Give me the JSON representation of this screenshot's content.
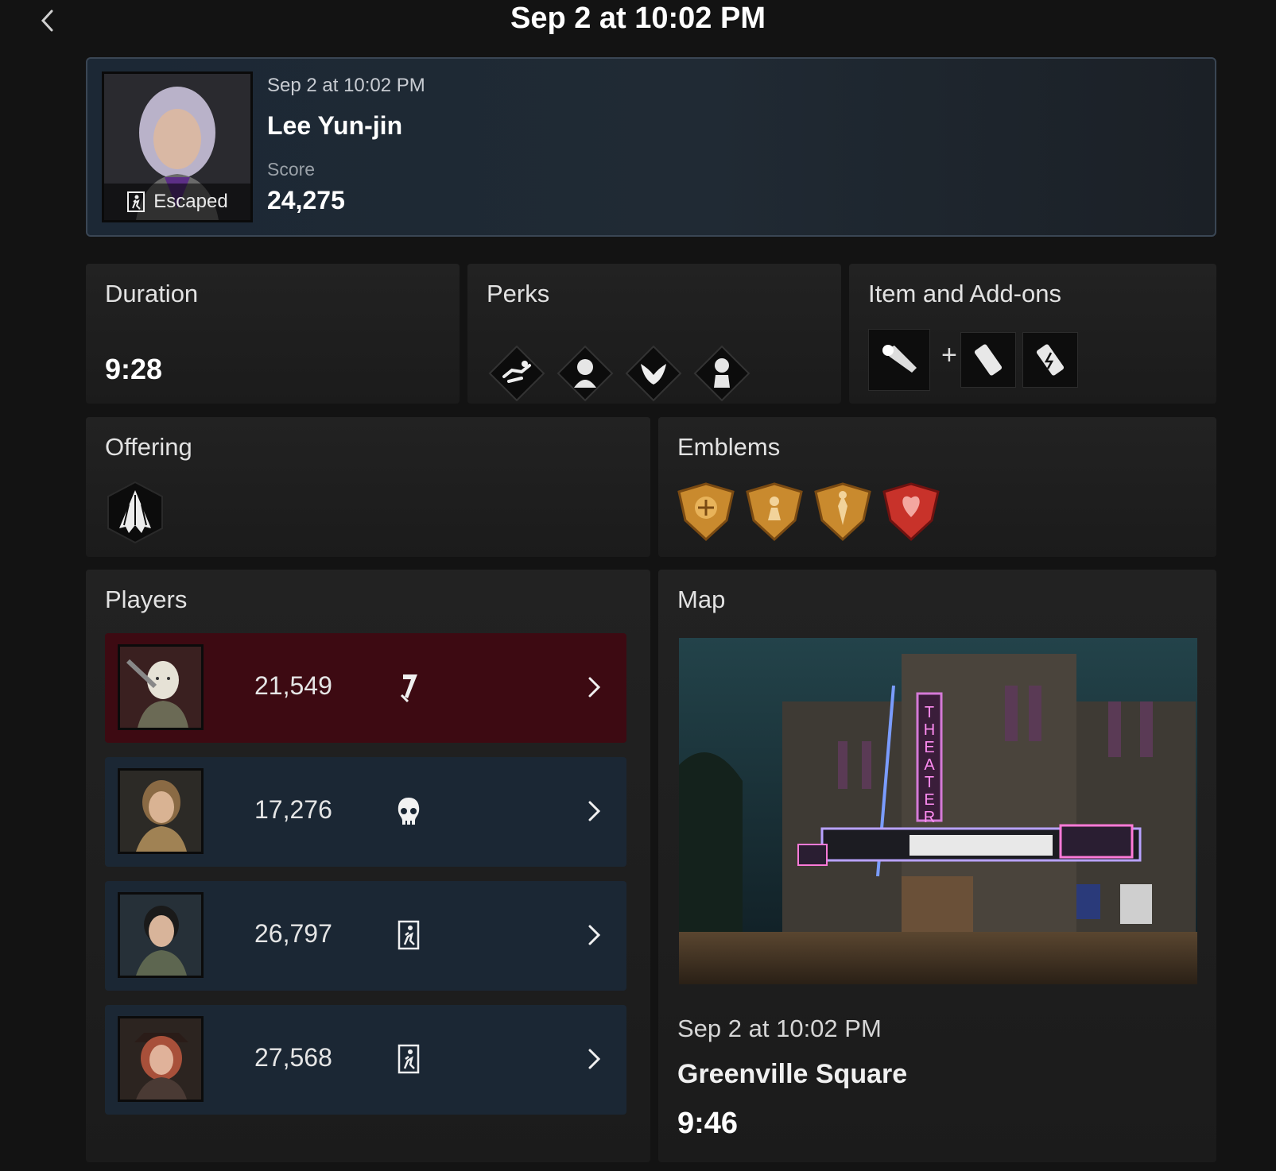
{
  "header": {
    "title": "Sep 2 at 10:02 PM"
  },
  "match": {
    "date": "Sep 2 at 10:02 PM",
    "character": "Lee Yun-jin",
    "status": "Escaped",
    "score_label": "Score",
    "score": "24,275"
  },
  "duration": {
    "title": "Duration",
    "value": "9:28"
  },
  "perks": {
    "title": "Perks",
    "icons": [
      "vault-perk-icon",
      "survivor-portrait-perk-icon",
      "wings-perk-icon",
      "bust-perk-icon"
    ]
  },
  "items": {
    "title": "Item and Add-ons",
    "plus": "+",
    "icons": [
      "flashlight-icon",
      "battery-icon",
      "battery-charged-icon"
    ]
  },
  "offering": {
    "title": "Offering",
    "icon": "shroud-offering-icon"
  },
  "emblems": {
    "title": "Emblems",
    "icons": [
      "gold-emblem-lightbringer-icon",
      "gold-emblem-unbroken-icon",
      "gold-emblem-benevolent-icon",
      "iridescent-emblem-evader-icon"
    ]
  },
  "players": {
    "title": "Players",
    "rows": [
      {
        "score": "21,549",
        "status_icon": "killer-blade-icon",
        "role": "killer"
      },
      {
        "score": "17,276",
        "status_icon": "skull-icon",
        "role": "survivor"
      },
      {
        "score": "26,797",
        "status_icon": "escaped-icon",
        "role": "survivor"
      },
      {
        "score": "27,568",
        "status_icon": "escaped-icon",
        "role": "survivor"
      }
    ]
  },
  "map": {
    "title": "Map",
    "date": "Sep 2 at 10:02 PM",
    "name": "Greenville Square",
    "time": "9:46",
    "marquee_sign": "THEATER"
  },
  "colors": {
    "killer_row": "#3d0a12",
    "survivor_row": "#1b2734",
    "hero_border": "#3a4654"
  }
}
